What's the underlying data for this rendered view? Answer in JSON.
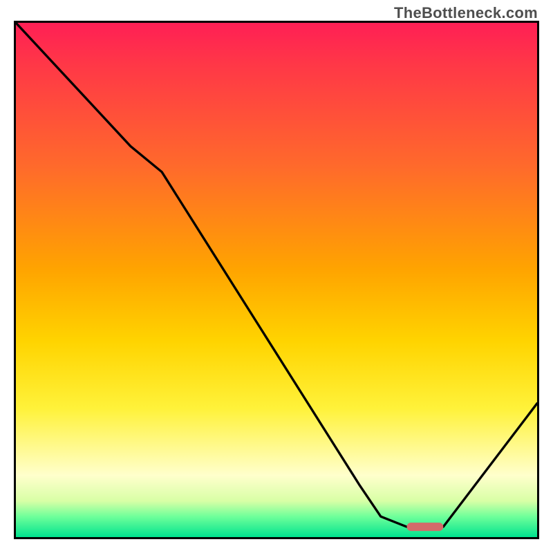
{
  "watermark": "TheBottleneck.com",
  "chart_data": {
    "type": "line",
    "title": "",
    "xlabel": "",
    "ylabel": "",
    "xlim": [
      0,
      100
    ],
    "ylim": [
      0,
      100
    ],
    "series": [
      {
        "name": "curve",
        "points": [
          {
            "x": 0,
            "y": 100
          },
          {
            "x": 22,
            "y": 76
          },
          {
            "x": 28,
            "y": 71
          },
          {
            "x": 66,
            "y": 10
          },
          {
            "x": 70,
            "y": 4
          },
          {
            "x": 75,
            "y": 2
          },
          {
            "x": 82,
            "y": 2
          },
          {
            "x": 100,
            "y": 26
          }
        ]
      }
    ],
    "marker": {
      "name": "optimal-range",
      "x_start": 75,
      "x_end": 82,
      "y": 2,
      "color": "#d46a6a"
    },
    "background_gradient": {
      "orientation": "vertical",
      "stops": [
        {
          "pos": 0.0,
          "color": "#ff1f55"
        },
        {
          "pos": 0.28,
          "color": "#ff6a2b"
        },
        {
          "pos": 0.48,
          "color": "#ffa400"
        },
        {
          "pos": 0.75,
          "color": "#fff23a"
        },
        {
          "pos": 0.93,
          "color": "#d8ffa6"
        },
        {
          "pos": 1.0,
          "color": "#00e38f"
        }
      ]
    }
  }
}
